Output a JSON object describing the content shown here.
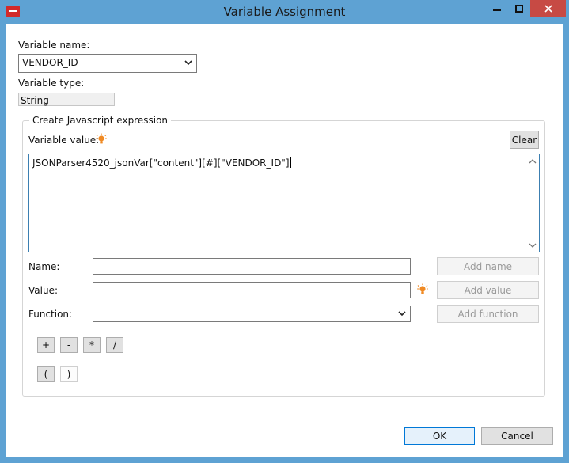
{
  "window": {
    "title": "Variable Assignment"
  },
  "variable_name": {
    "label": "Variable name:",
    "value": "VENDOR_ID"
  },
  "variable_type": {
    "label": "Variable type:",
    "value": "String"
  },
  "expression_group": {
    "title": "Create Javascript expression",
    "value_label": "Variable value:",
    "clear_label": "Clear",
    "expression": "JSONParser4520_jsonVar[\"content\"][#][\"VENDOR_ID\"]"
  },
  "builder": {
    "name_label": "Name:",
    "value_label": "Value:",
    "function_label": "Function:",
    "name_value": "",
    "value_value": "",
    "function_value": "",
    "add_name_label": "Add name",
    "add_value_label": "Add value",
    "add_function_label": "Add function"
  },
  "operators": {
    "plus": "+",
    "minus": "-",
    "multiply": "*",
    "divide": "/",
    "open_paren": "(",
    "close_paren": ")"
  },
  "footer": {
    "ok_label": "OK",
    "cancel_label": "Cancel"
  },
  "colors": {
    "titlebar": "#5ea2d3",
    "close": "#c74a44",
    "accent_bulb": "#f08a24"
  },
  "icons": {
    "app": "app-logo-icon",
    "bulb": "lightbulb-icon"
  }
}
